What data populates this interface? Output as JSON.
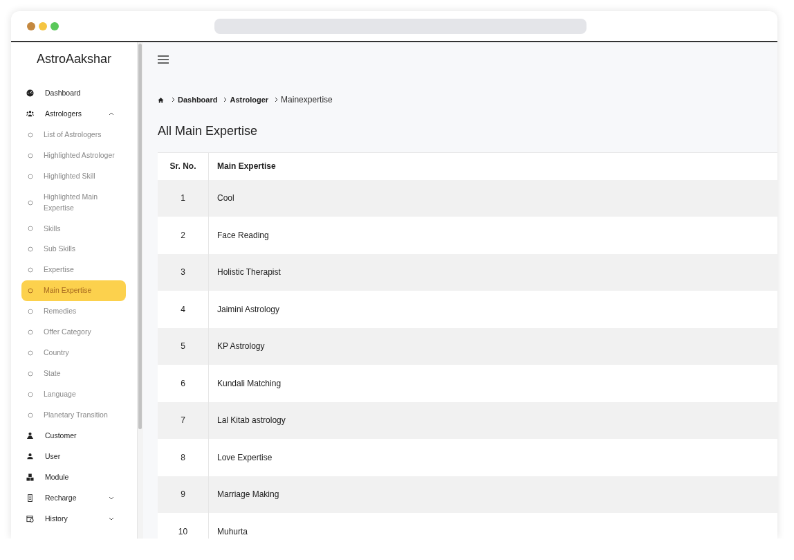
{
  "sidebar": {
    "logo": "AstroAakshar",
    "items": [
      {
        "label": "Dashboard",
        "selected": false
      },
      {
        "label": "Astrologers",
        "selected": false,
        "expanded": true,
        "children": [
          {
            "label": "List of Astrologers",
            "selected": false
          },
          {
            "label": "Highlighted Astrologer",
            "selected": false
          },
          {
            "label": "Highlighted Skill",
            "selected": false
          },
          {
            "label": "Highlighted Main Expertise",
            "selected": false
          },
          {
            "label": "Skills",
            "selected": false
          },
          {
            "label": "Sub Skills",
            "selected": false
          },
          {
            "label": "Expertise",
            "selected": false
          },
          {
            "label": "Main Expertise",
            "selected": true
          },
          {
            "label": "Remedies",
            "selected": false
          },
          {
            "label": "Offer Category",
            "selected": false
          },
          {
            "label": "Country",
            "selected": false
          },
          {
            "label": "State",
            "selected": false
          },
          {
            "label": "Language",
            "selected": false
          },
          {
            "label": "Planetary Transition",
            "selected": false
          }
        ]
      },
      {
        "label": "Customer",
        "selected": false
      },
      {
        "label": "User",
        "selected": false
      },
      {
        "label": "Module",
        "selected": false
      },
      {
        "label": "Recharge",
        "selected": false,
        "expanded": false
      },
      {
        "label": "History",
        "selected": false,
        "expanded": false
      }
    ]
  },
  "breadcrumb": [
    "Dashboard",
    "Astrologer",
    "Mainexpertise"
  ],
  "page_title": "All Main Expertise",
  "table": {
    "columns": [
      "Sr. No.",
      "Main Expertise"
    ],
    "rows": [
      [
        "1",
        "Cool"
      ],
      [
        "2",
        "Face Reading"
      ],
      [
        "3",
        "Holistic Therapist"
      ],
      [
        "4",
        "Jaimini Astrology"
      ],
      [
        "5",
        "KP Astrology"
      ],
      [
        "6",
        "Kundali Matching"
      ],
      [
        "7",
        "Lal Kitab astrology"
      ],
      [
        "8",
        "Love Expertise"
      ],
      [
        "9",
        "Marriage Making"
      ],
      [
        "10",
        "Muhurta"
      ]
    ]
  }
}
